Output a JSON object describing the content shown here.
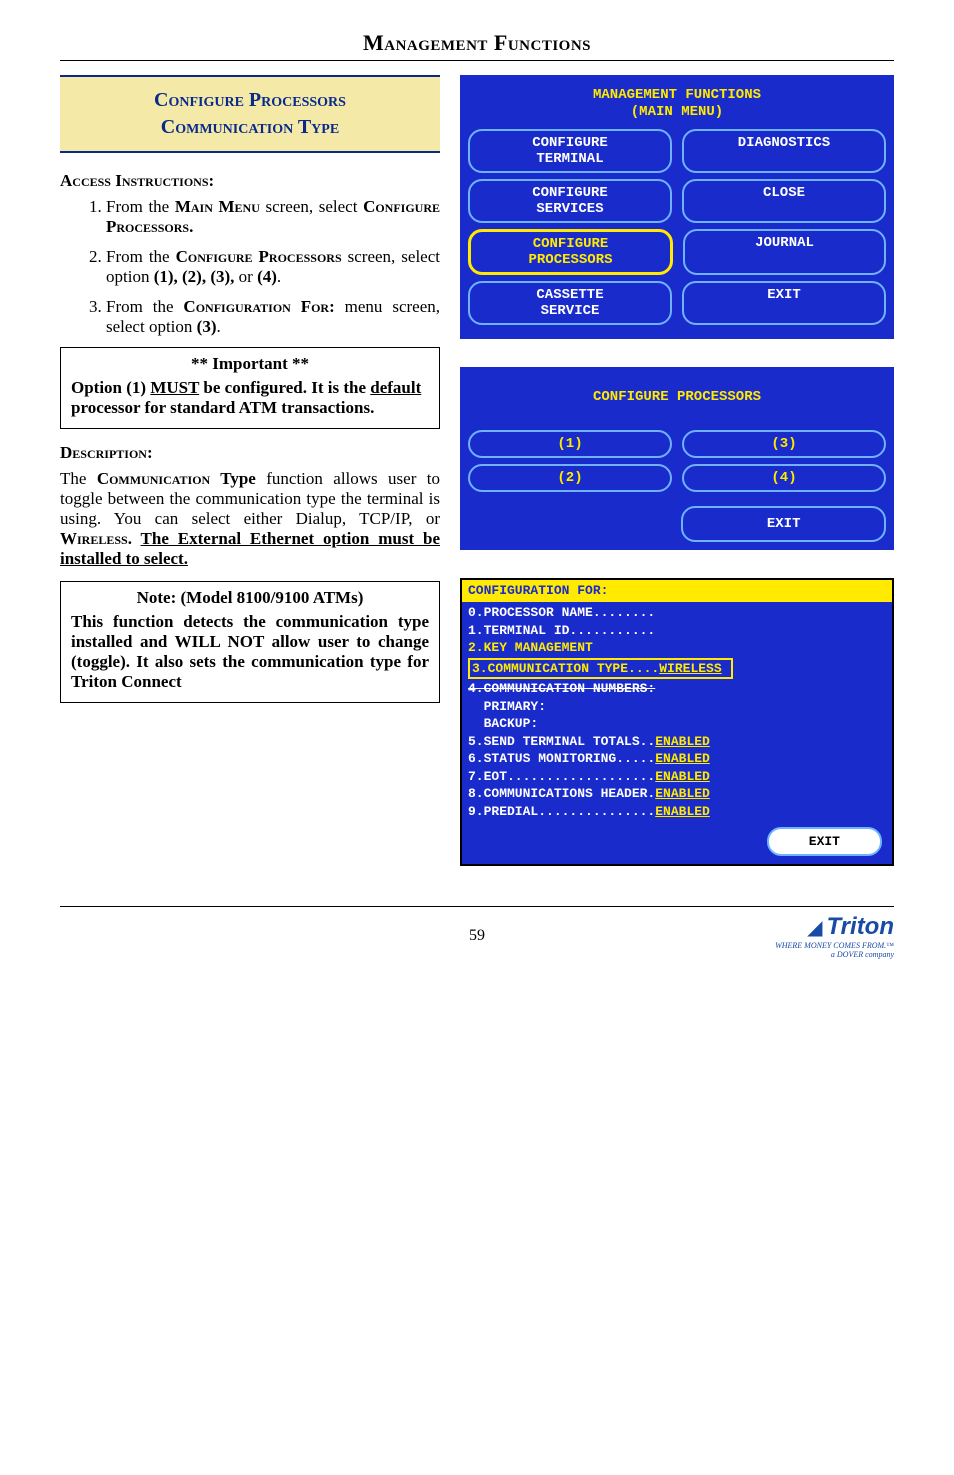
{
  "header": {
    "title": "Management Functions"
  },
  "titlebox": {
    "line1": "Configure Processors",
    "line2": "Communication Type"
  },
  "access": {
    "heading": "Access Instructions:",
    "steps": [
      {
        "pre": "From the ",
        "sc1": "Main Menu",
        "mid": " screen, select ",
        "sc2": "Configure Processors."
      },
      {
        "pre": "From the ",
        "sc1": "Configure Processors",
        "mid": " screen, select option ",
        "opts": "(1), (2), (3), ",
        "or": "or ",
        "last": "(4)",
        "tail": "."
      },
      {
        "pre": "From the ",
        "sc1": "Configuration For:",
        "mid": " menu screen, select option ",
        "opt": " (3)",
        "tail": "."
      }
    ]
  },
  "important": {
    "title": "** Important **",
    "body_pre": "Option (1) ",
    "body_must": "MUST",
    "body_mid": " be configured. It is the ",
    "body_def": "default",
    "body_post": " processor for standard ATM transactions."
  },
  "description": {
    "heading": "Description:",
    "body_pre": "The ",
    "sc": "Communication",
    "body_mid1": " Type",
    "body_mid2": " function allows user to toggle between the communication type the terminal is using. You can select either Dialup, TCP/IP, or ",
    "sc2": "Wireless",
    "body_dot": ".  ",
    "under": "The External Ethernet option must be installed to select."
  },
  "note": {
    "title": "Note: (Model 8100/9100 ATMs)",
    "body": "This function detects the communication type installed and WILL NOT allow user to change (toggle). It also sets the communication type for Triton Connect"
  },
  "screen1": {
    "title": "MANAGEMENT FUNCTIONS\n(MAIN MENU)",
    "buttons": [
      [
        "CONFIGURE\nTERMINAL",
        "DIAGNOSTICS"
      ],
      [
        "CONFIGURE\nSERVICES",
        "CLOSE"
      ],
      [
        "CONFIGURE\nPROCESSORS",
        "JOURNAL"
      ],
      [
        "CASSETTE\nSERVICE",
        "EXIT"
      ]
    ],
    "highlight": [
      2,
      0
    ]
  },
  "screen2": {
    "title": "CONFIGURE PROCESSORS",
    "rows": [
      [
        "(1)",
        "(3)"
      ],
      [
        "(2)",
        "(4)"
      ]
    ],
    "exit": "EXIT"
  },
  "screen3": {
    "header": "CONFIGURATION FOR:",
    "lines": {
      "l0": "0.PROCESSOR NAME........",
      "l1": "1.TERMINAL ID...........",
      "l2": "2.KEY MANAGEMENT",
      "l3a": "3.COMMUNICATION TYPE....",
      "l3b": "WIRELESS",
      "l4": "4.COMMUNICATION NUMBERS:",
      "lp": "  PRIMARY:",
      "lb": "  BACKUP:",
      "l5a": "5.SEND TERMINAL TOTALS..",
      "l5b": "ENABLED",
      "l6a": "6.STATUS MONITORING.....",
      "l6b": "ENABLED",
      "l7a": "7.EOT...................",
      "l7b": "ENABLED",
      "l8a": "8.COMMUNICATIONS HEADER.",
      "l8b": "ENABLED",
      "l9a": "9.PREDIAL...............",
      "l9b": "ENABLED"
    },
    "exit": "EXIT"
  },
  "footer": {
    "page": "59",
    "logo": "Triton",
    "tag": "WHERE MONEY COMES FROM.™",
    "dover": "a DOVER company"
  }
}
